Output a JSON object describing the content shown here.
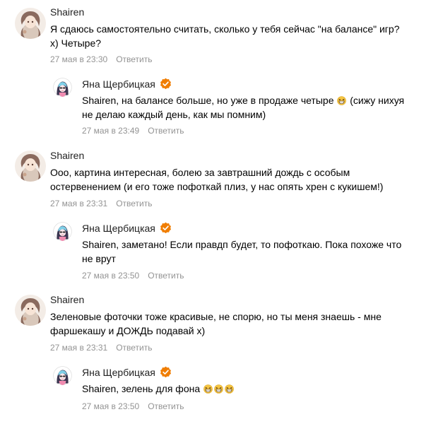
{
  "comments": [
    {
      "author": "Shairen",
      "line1": "Я сдаюсь самостоятельно считать, сколько у тебя сейчас \"на балансе\" игр?",
      "line2": "х) Четыре?",
      "date": "27 мая в 23:30",
      "reply": "Ответить"
    },
    {
      "author": "Яна Щербицкая",
      "line1_a": "Shairen, на балансе больше, но уже в продаже четыре",
      "line1_b": "(сижу нихуя",
      "line2": "не делаю каждый день, как мы помним)",
      "date": "27 мая в 23:49",
      "reply": "Ответить"
    },
    {
      "author": "Shairen",
      "line1": "Ооо, картина интересная, болею за завтрашний дождь с особым",
      "line2": "остервенением (и его тоже пофоткай плиз, у нас опять хрен с кукишем!)",
      "date": "27 мая в 23:31",
      "reply": "Ответить"
    },
    {
      "author": "Яна Щербицкая",
      "line1": "Shairen, заметано! Если правдп будет, то пофоткаю. Пока похоже что",
      "line2": "не врут",
      "date": "27 мая в 23:50",
      "reply": "Ответить"
    },
    {
      "author": "Shairen",
      "line1": "Зеленовые фоточки тоже красивые, не спорю, но ты меня знаешь - мне",
      "line2": "фаршекашу и ДОЖДЬ подавай х)",
      "date": "27 мая в 23:31",
      "reply": "Ответить"
    },
    {
      "author": "Яна Щербицкая",
      "line1": "Shairen, зелень для фона",
      "date": "27 мая в 23:50",
      "reply": "Ответить"
    }
  ],
  "colors": {
    "verified_badge": "#f07d00",
    "meta_text": "#939393",
    "emoji": "#f5c542"
  },
  "icons": {
    "verified": "verified-checkmark-icon",
    "emoji": "grinning-squinting-face-emoji"
  }
}
